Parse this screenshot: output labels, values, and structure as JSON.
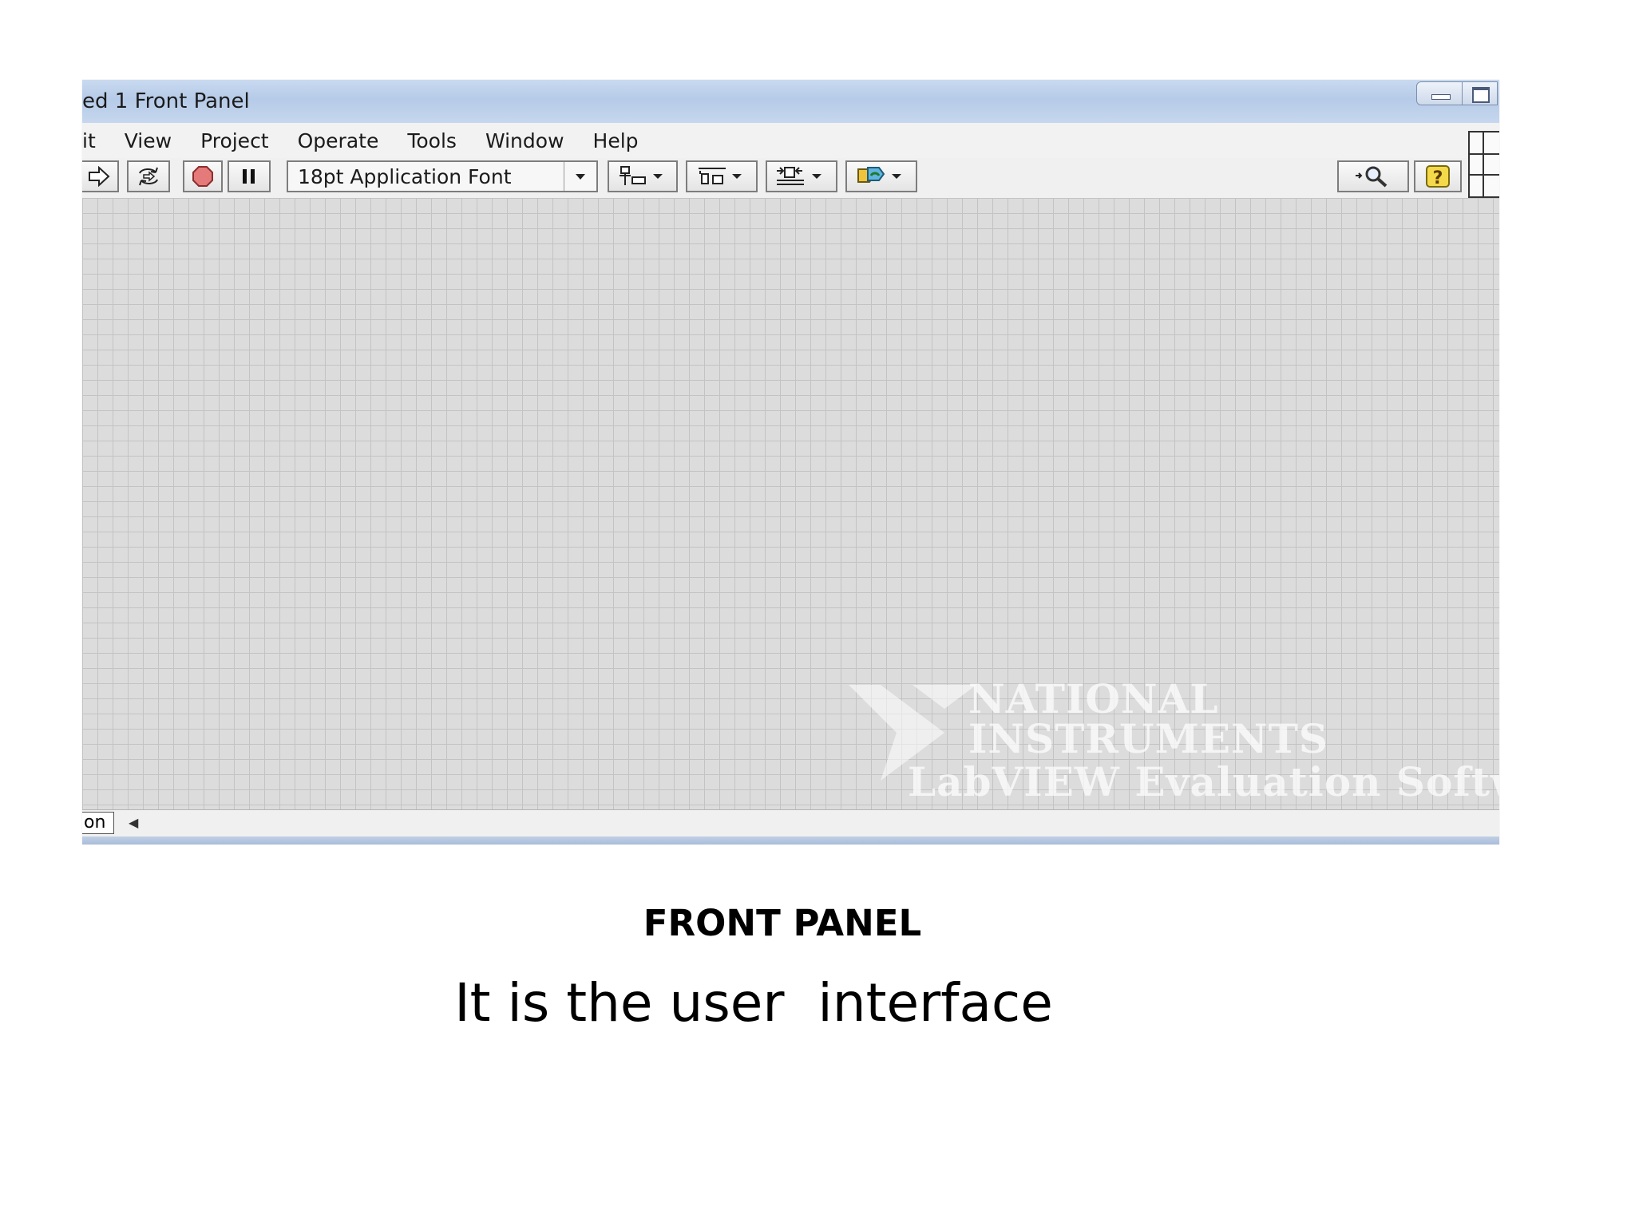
{
  "window": {
    "title": "ed 1 Front Panel",
    "controls": [
      "minimize-icon",
      "maximize-icon"
    ]
  },
  "menubar": {
    "items": [
      "it",
      "View",
      "Project",
      "Operate",
      "Tools",
      "Window",
      "Help"
    ]
  },
  "toolbar": {
    "run_icon": "run-arrow-icon",
    "run_continuously_icon": "run-continuously-icon",
    "abort_icon": "abort-stop-icon",
    "pause_icon": "pause-icon",
    "font_select_value": "18pt Application Font",
    "align_icon": "align-objects-icon",
    "distribute_icon": "distribute-objects-icon",
    "resize_icon": "resize-objects-icon",
    "reorder_icon": "reorder-icon",
    "search_icon": "search-icon",
    "help_icon": "context-help-icon"
  },
  "canvas": {
    "watermark": {
      "line1": "NATIONAL",
      "line2": "INSTRUMENTS",
      "line3": "LabVIEW Evaluation Softwa"
    }
  },
  "statusbar": {
    "tab_label": "on"
  },
  "caption": {
    "title": "FRONT PANEL",
    "body": "It is the user  interface"
  },
  "colors": {
    "titlebar": "#c9daf0",
    "canvas": "#dcdcdc",
    "grid": "#c3c3c3",
    "abort_red": "#e05555",
    "help_yellow": "#f2d23a"
  }
}
